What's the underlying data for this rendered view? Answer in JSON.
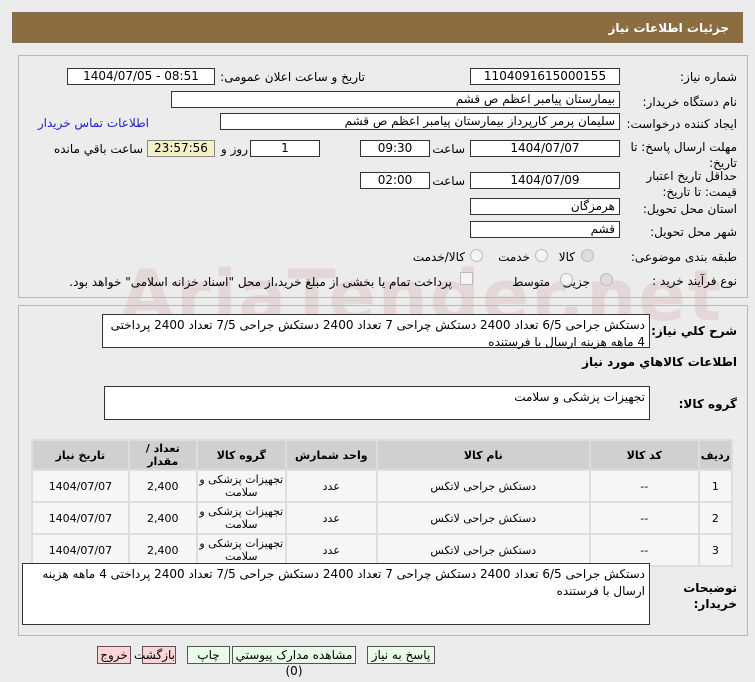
{
  "header": {
    "title": "جزئیات اطلاعات نیاز"
  },
  "watermark": "AriaTender.net",
  "form": {
    "need_number_label": "شماره نیاز:",
    "need_number": "1104091615000155",
    "announce_label": "تاریخ و ساعت اعلان عمومی:",
    "announce_value": "1404/07/05 - 08:51",
    "buyer_org_label": "نام دستگاه خریدار:",
    "buyer_org": "بیمارستان پیامبر اعظم  ص  قشم",
    "creator_label": "ایجاد کننده درخواست:",
    "creator": "سلیمان پرمر کارپرداز بیمارستان پیامبر اعظم  ص  قشم",
    "contact_link": "اطلاعات تماس خریدار",
    "deadline_label": "مهلت ارسال پاسخ: تا تاریخ:",
    "deadline_date": "1404/07/07",
    "time_label": "ساعت",
    "deadline_time": "09:30",
    "days": "1",
    "days_label": "روز و",
    "remaining": "23:57:56",
    "remaining_label": "ساعت باقي مانده",
    "validity_label": "حداقل تاریخ اعتبار قیمت: تا تاریخ:",
    "validity_date": "1404/07/09",
    "validity_time": "02:00",
    "province_label": "استان محل تحویل:",
    "province": "هرمزگان",
    "city_label": "شهر محل تحویل:",
    "city": "قشم",
    "category_label": "طبقه بندی موضوعی:",
    "category_options": [
      "کالا",
      "خدمت",
      "کالا/خدمت"
    ],
    "category_selected": "کالا",
    "process_label": "نوع فرآیند خرید :",
    "process_options": [
      "جزیی",
      "متوسط"
    ],
    "process_selected": "جزیی",
    "payment_note": "پرداخت تمام یا بخشی از مبلغ خرید،از محل \"اسناد خزانه اسلامی\" خواهد بود."
  },
  "details": {
    "summary_label": "شرح کلي نیاز:",
    "summary": "دستکش جراحی 6/5 تعداد 2400 دستکش چراحی 7 تعداد 2400 دستکش جراحی 7/5 تعداد 2400 پرداختی 4 ماهه هزینه ارسال با فرستنده",
    "goods_heading": "اطلاعات کالاهاي مورد نیاز",
    "group_label": "گروه کالا:",
    "group": "تجهیزات پزشکی و سلامت",
    "table": {
      "headers": [
        "ردیف",
        "کد کالا",
        "نام کالا",
        "واحد شمارش",
        "گروه کالا",
        "تعداد / مقدار",
        "تاریخ نیاز"
      ],
      "rows": [
        [
          "1",
          "--",
          "دستکش جراحی لاتکس",
          "عدد",
          "تجهیزات پزشکی و سلامت",
          "2,400",
          "1404/07/07"
        ],
        [
          "2",
          "--",
          "دستکش جراحی لاتکس",
          "عدد",
          "تجهیزات پزشکی و سلامت",
          "2,400",
          "1404/07/07"
        ],
        [
          "3",
          "--",
          "دستکش جراحی لاتکس",
          "عدد",
          "تجهیزات پزشکی و سلامت",
          "2,400",
          "1404/07/07"
        ]
      ]
    },
    "buyer_notes_label": "توضیحات خریدار:",
    "buyer_notes": "دستکش جراحی 6/5 تعداد 2400 دستکش چراحی 7 تعداد 2400 دستکش جراحی 7/5 تعداد 2400 پرداختی 4 ماهه هزینه ارسال با فرستنده"
  },
  "buttons": {
    "reply": "پاسخ به نیاز",
    "attachments": "مشاهده مدارک پیوستي (0)",
    "print": "چاپ",
    "back": "بازگشت",
    "exit": "خروج"
  }
}
